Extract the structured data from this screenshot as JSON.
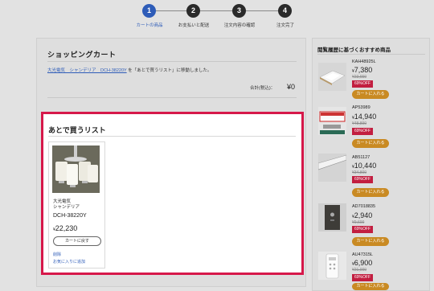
{
  "stepper": {
    "steps": [
      {
        "num": "1",
        "label": "カートの商品"
      },
      {
        "num": "2",
        "label": "お支払いと配送"
      },
      {
        "num": "3",
        "label": "注文内容の確認"
      },
      {
        "num": "4",
        "label": "注文完了"
      }
    ]
  },
  "cart": {
    "title": "ショッピングカート",
    "moved_link": "大光電気　シャンデリア　DCH-38220Y",
    "moved_suffix": "を「あとで買うリスト」に移動しました。",
    "total_label": "合計(税込)：",
    "total_value": "¥0"
  },
  "later": {
    "title": "あとで買うリスト",
    "item": {
      "maker": "大光電気",
      "category": "シャンデリア",
      "model": "DCH-38220Y",
      "price": "22,230",
      "currency": "¥",
      "cart_button": "カートに戻す",
      "delete_link": "削除",
      "fav_link": "お気に入りに追加"
    }
  },
  "sidebar": {
    "title": "閲覧履歴に基づくおすすめ商品",
    "items": [
      {
        "model": "KAH48925L",
        "price": "7,380",
        "old": "¥23,650",
        "off": "69%OFF",
        "button": "カートに入れる",
        "icon": "ceiling-light-icon"
      },
      {
        "model": "AP53989",
        "price": "14,940",
        "old": "¥48,890",
        "off": "69%OFF",
        "button": "カートに入れる",
        "icon": "wall-light-icon"
      },
      {
        "model": "AB51127",
        "price": "10,440",
        "old": "¥34,800",
        "off": "69%OFF",
        "button": "カートに入れる",
        "icon": "bar-light-icon"
      },
      {
        "model": "AD7018835",
        "price": "2,940",
        "old": "¥9,600",
        "off": "69%OFF",
        "button": "カートに入れる",
        "icon": "switch-panel-icon"
      },
      {
        "model": "AU47315L",
        "price": "6,900",
        "old": "¥21,000",
        "off": "69%OFF",
        "button": "カートに入れる",
        "icon": "remote-control-icon"
      }
    ]
  }
}
